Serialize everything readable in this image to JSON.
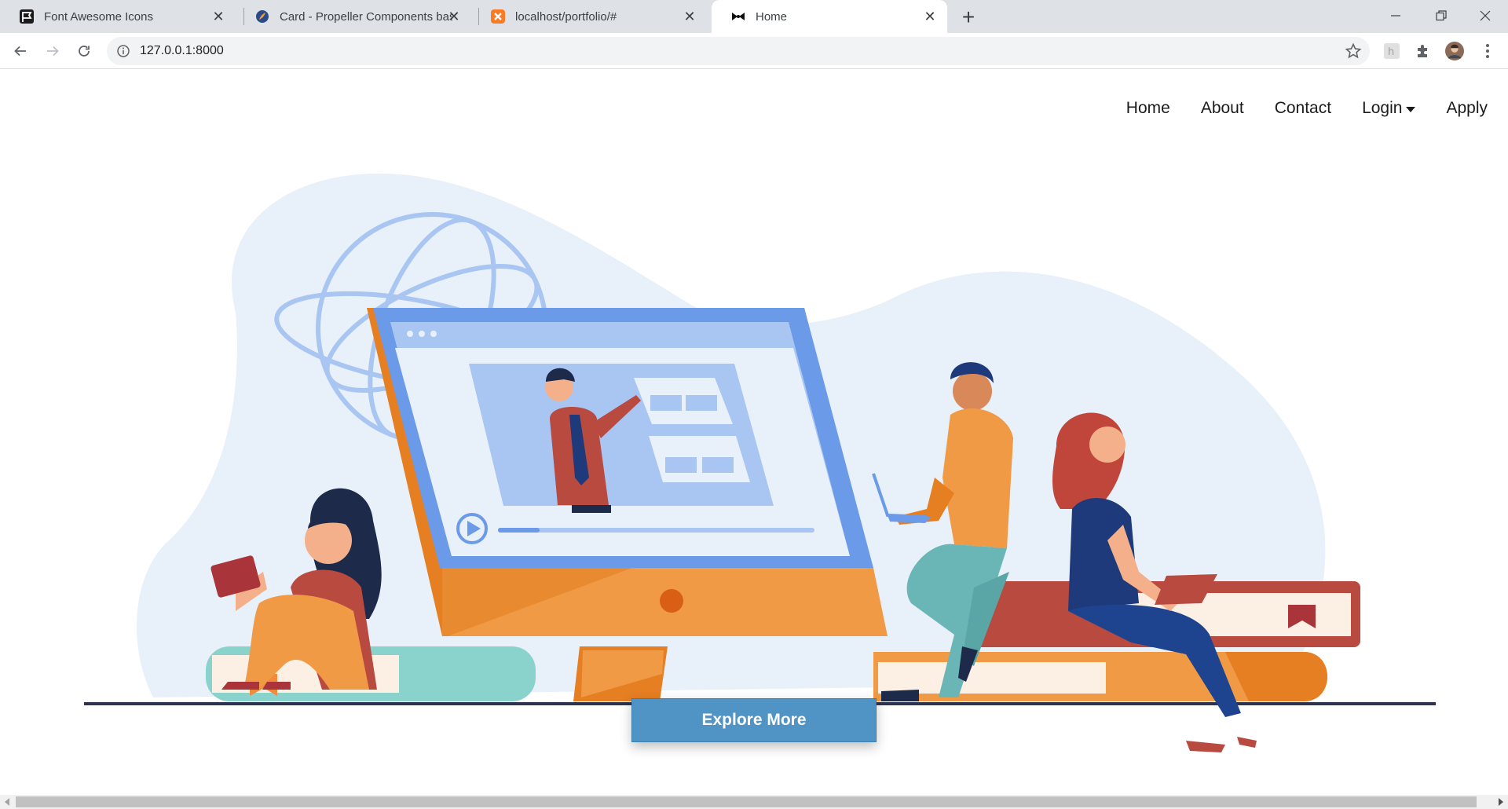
{
  "browser": {
    "tabs": [
      {
        "title": "Font Awesome Icons",
        "icon": "font-awesome-flag-icon"
      },
      {
        "title": "Card - Propeller Components based on Bootstrap",
        "icon": "propeller-icon"
      },
      {
        "title": "localhost/portfolio/#",
        "icon": "xampp-icon"
      },
      {
        "title": "Home",
        "icon": "bowtie-icon"
      }
    ],
    "active_tab_index": 3,
    "url": "127.0.0.1:8000",
    "accent": "#1a73e8"
  },
  "nav": {
    "items": [
      "Home",
      "About",
      "Contact",
      "Login",
      "Apply"
    ],
    "dropdown_item": "Login"
  },
  "hero": {
    "cta_label": "Explore More",
    "colors": {
      "cta": "#4f94c4",
      "blob": "#e8f0f9",
      "monitor_frame": "#6b9ae8",
      "orange": "#f19a45",
      "red_book": "#b84a40",
      "teal_book": "#8ad2cc",
      "ground": "#2c3350"
    }
  }
}
